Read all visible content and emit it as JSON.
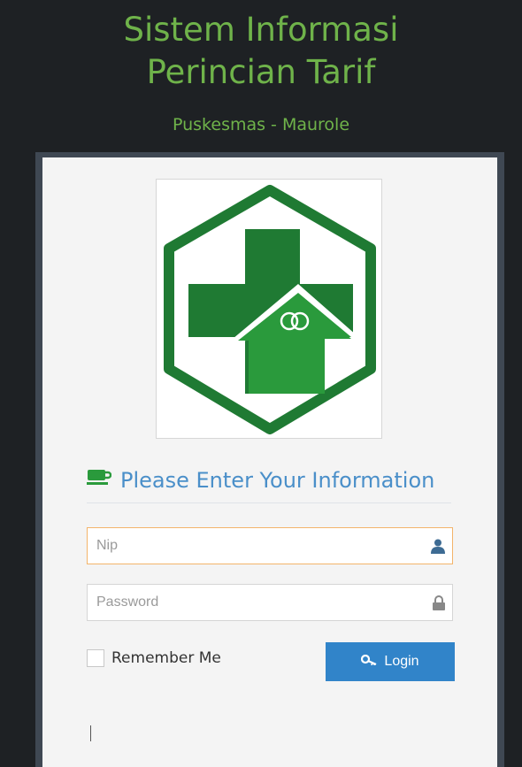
{
  "header": {
    "title_line1": "Sistem Informasi",
    "title_line2": "Perincian Tarif",
    "subtitle": "Puskesmas - Maurole"
  },
  "form": {
    "heading": "Please Enter Your Information",
    "nip_placeholder": "Nip",
    "password_placeholder": "Password",
    "remember_label": "Remember Me",
    "login_label": "Login"
  },
  "colors": {
    "title_green": "#6fb34a",
    "accent_blue": "#3184c9",
    "logo_dark_green": "#1f7a33",
    "logo_light_green": "#2a9a3c"
  },
  "icons": {
    "heading_icon": "coffee-cup-icon",
    "nip_icon": "user-icon",
    "password_icon": "lock-icon",
    "login_icon": "key-icon"
  }
}
